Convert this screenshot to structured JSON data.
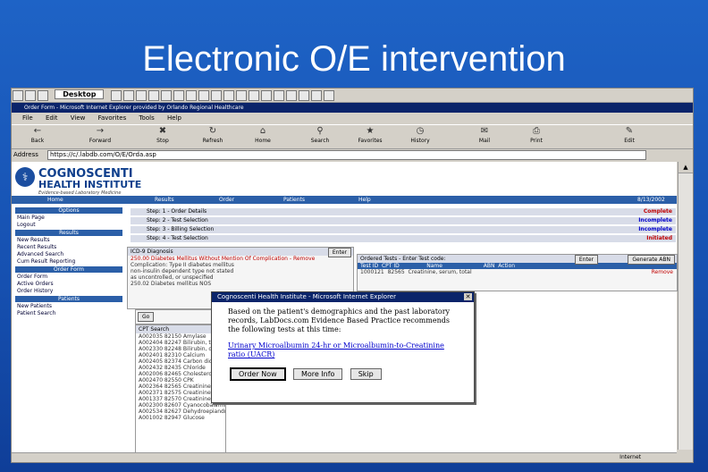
{
  "slide": {
    "title": "Electronic O/E intervention"
  },
  "taskbar": {
    "desktop_label": "Desktop"
  },
  "browser": {
    "window_title": "Order Form - Microsoft Internet Explorer provided by Orlando Regional Healthcare",
    "menu": [
      "File",
      "Edit",
      "View",
      "Favorites",
      "Tools",
      "Help"
    ],
    "toolbar": [
      "Back",
      "Forward",
      "Stop",
      "Refresh",
      "Home",
      "Search",
      "Favorites",
      "History",
      "Mail",
      "Print",
      "Edit"
    ],
    "address_label": "Address",
    "address_url": "https://c/.labdb.com/O/E/Orda.asp"
  },
  "site": {
    "logo_line1": "COGNOSCENTI",
    "logo_line2": "HEALTH INSTITUTE",
    "logo_tagline": "Evidence-based Laboratory Medicine",
    "nav": [
      "Home",
      "Results",
      "Order",
      "Patients",
      "Help"
    ],
    "date": "8/13/2002"
  },
  "leftnav": {
    "sections": [
      {
        "title": "Options",
        "items": [
          "Main Page",
          "Logout"
        ]
      },
      {
        "title": "Results",
        "items": [
          "New Results",
          "Recent Results",
          "Advanced Search",
          "Cum Result Reporting"
        ]
      },
      {
        "title": "Order Form",
        "items": [
          "Order Form",
          "Active Orders",
          "Order History"
        ]
      },
      {
        "title": "Patients",
        "items": [
          "New Patients",
          "Patient Search"
        ]
      }
    ]
  },
  "steps": [
    {
      "label": "Step: 1 - Order Details",
      "status": "Complete",
      "color": "#c00000"
    },
    {
      "label": "Step: 2 - Test Selection",
      "status": "Incomplete",
      "color": "#0000cc"
    },
    {
      "label": "Step: 3 - Billing Selection",
      "status": "Incomplete",
      "color": "#0000cc"
    },
    {
      "label": "Step: 4 - Test Selection",
      "status": "Initiated",
      "color": "#c00000"
    }
  ],
  "dx_panel": {
    "header": "ICD-9 Diagnosis",
    "enter_label": "Enter",
    "lines": [
      "250.00 Diabetes Mellitus Without Mention Of Complication - Remove",
      "Complication: Type II diabetes mellitus",
      "non-insulin dependent type not stated",
      "as uncontrolled, or unspecified",
      "250.02 Diabetes mellitus NOS"
    ]
  },
  "ordered_panel": {
    "header": "Ordered Tests - Enter Test code:",
    "enter_label": "Enter",
    "abn_button": "Generate ABN",
    "columns": [
      "Test ID",
      "CPT ID",
      "Name",
      "ABN",
      "Action"
    ],
    "rows": [
      {
        "test": "1000121",
        "cpt": "82565",
        "name": "Creatinine, serum, total",
        "action": "Remove"
      }
    ]
  },
  "test_list": {
    "search_label": "CPT Search",
    "go": "Go",
    "rows": [
      "A002035 82150 Amylase",
      "A002404 82247 Bilirubin, total",
      "A002330 82248 Bilirubin, direct",
      "A002401 82310 Calcium",
      "A002405 82374 Carbon dioxide",
      "A002432 82435 Chloride",
      "A002006 82465 Cholesterol",
      "A002470 82550 CPK",
      "A002364 82565 Creatinine",
      "A002371 82575 Creatinine clearance",
      "A001337 82570 Creatinine, urine",
      "A002300 82607 Cyanocobalamin (Vitamin B-12)",
      "A002534 82627 Dehydroepiandrosterone sulfate (DHEA-S)",
      "A001002 82947 Glucose"
    ]
  },
  "dialog": {
    "title": "Cognoscenti Health Institute - Microsoft Internet Explorer",
    "message": "Based on the patient's demographics and the past laboratory records, LabDocs.com Evidence Based Practice recommends the following tests at this time:",
    "link": "Urinary Microalbumin 24-hr or Microalbumin-to-Creatinine ratio (UACR)",
    "buttons": [
      "Order Now",
      "More Info",
      "Skip"
    ]
  },
  "status": {
    "zone": "Internet"
  }
}
